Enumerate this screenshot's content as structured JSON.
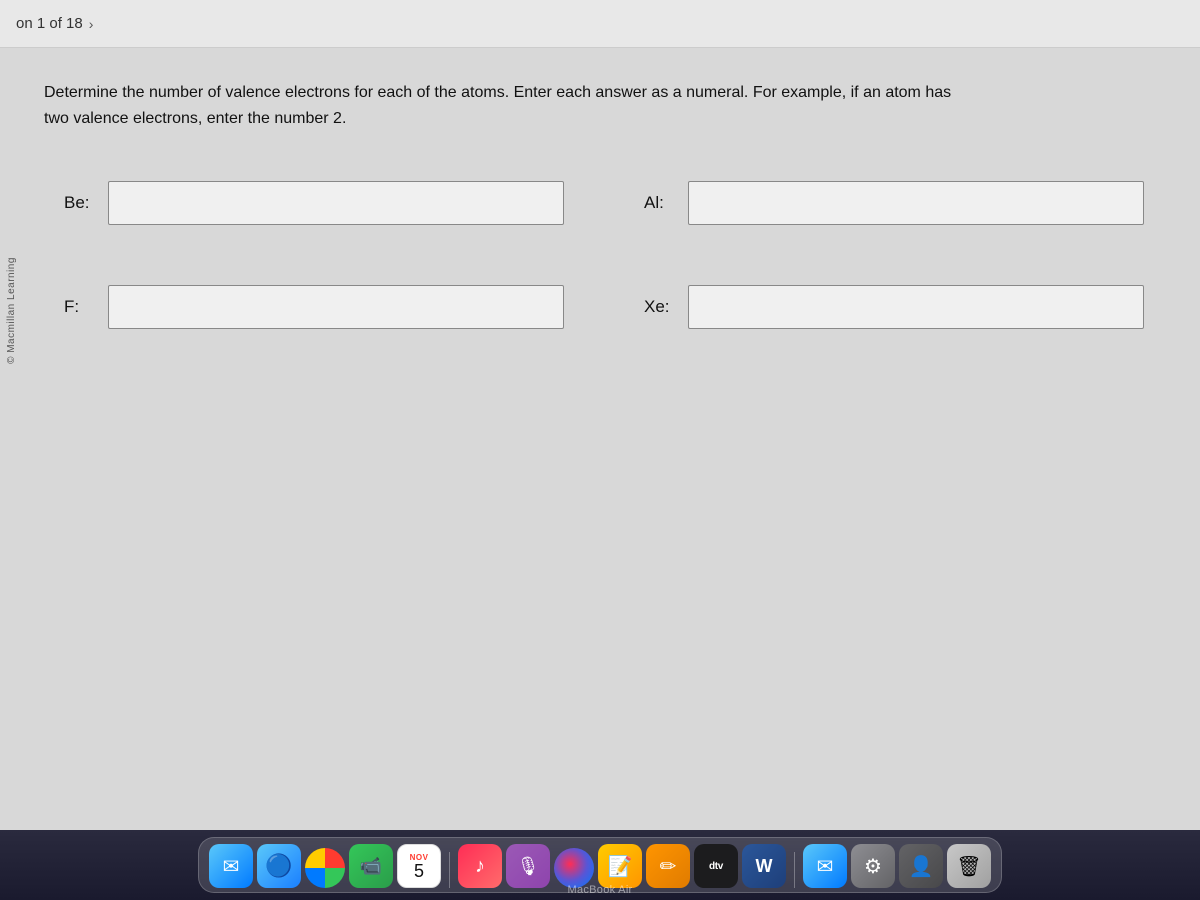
{
  "nav": {
    "pagination_text": "on 1 of 18",
    "chevron": "›"
  },
  "copyright": "© Macmillan Learning",
  "question": {
    "instructions_line1": "Determine the number of valence electrons for each of the atoms. Enter each answer as a numeral. For example, if an atom has",
    "instructions_line2": "two valence electrons, enter the number 2.",
    "fields": [
      {
        "label": "Be:",
        "id": "be",
        "value": ""
      },
      {
        "label": "Al:",
        "id": "al",
        "value": ""
      },
      {
        "label": "F:",
        "id": "f",
        "value": ""
      },
      {
        "label": "Xe:",
        "id": "xe",
        "value": ""
      }
    ]
  },
  "dock": {
    "items": [
      {
        "name": "mail",
        "icon": "✉"
      },
      {
        "name": "finder",
        "icon": "🔵"
      },
      {
        "name": "photos",
        "icon": ""
      },
      {
        "name": "facetime",
        "icon": "📹"
      },
      {
        "name": "calendar",
        "month": "NOV",
        "day": "5"
      },
      {
        "name": "music",
        "icon": "♪"
      },
      {
        "name": "podcast",
        "icon": "🎙"
      },
      {
        "name": "siri",
        "icon": ""
      },
      {
        "name": "notes",
        "icon": "📝"
      },
      {
        "name": "pencil",
        "icon": "✏"
      },
      {
        "name": "atv",
        "label": "dtv"
      },
      {
        "name": "word",
        "label": "W"
      },
      {
        "name": "mail2",
        "icon": "✉"
      },
      {
        "name": "settings",
        "icon": "⚙"
      },
      {
        "name": "profile",
        "icon": "👤"
      },
      {
        "name": "trash",
        "icon": "🗑"
      }
    ]
  },
  "macbook_label": "MacBook Air"
}
